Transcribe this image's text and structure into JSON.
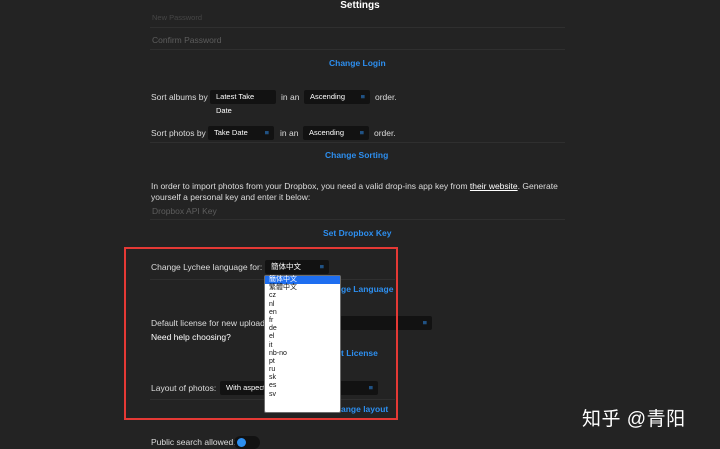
{
  "header": {
    "title": "Settings"
  },
  "login": {
    "new_password_placeholder": "New Password",
    "confirm_password_placeholder": "Confirm Password",
    "change_login_label": "Change Login"
  },
  "sorting": {
    "sort_albums_by": "Sort albums by",
    "albums_field": "Latest Take Date",
    "in_an": "in an",
    "albums_order": "Ascending",
    "order_suffix": "order.",
    "sort_photos_by": "Sort photos by",
    "photos_field": "Take Date",
    "photos_order": "Ascending",
    "change_sorting_label": "Change Sorting"
  },
  "dropbox": {
    "info_prefix": "In order to import photos from your Dropbox, you need a valid drop-ins app key from",
    "their_website": "their website",
    "info_suffix": ". Generate",
    "info_line2": "yourself a personal key and enter it below:",
    "api_key_placeholder": "Dropbox API Key",
    "set_key_label": "Set Dropbox Key"
  },
  "language": {
    "label": "Change Lychee language for:",
    "current": "簡体中文",
    "button_partial": "ge Language",
    "options": [
      "簡体中文",
      "繁體中文",
      "cz",
      "nl",
      "en",
      "fr",
      "de",
      "el",
      "it",
      "nb-no",
      "pt",
      "ru",
      "sk",
      "es",
      "sv"
    ],
    "selected_index": 0
  },
  "license": {
    "label": "Default license for new uploads",
    "help": "Need help choosing?",
    "button_partial": "t License"
  },
  "layout": {
    "label": "Layout of photos:",
    "current_partial": "With aspect,",
    "button_partial": "ange layout"
  },
  "public_search": {
    "label": "Public search allowed:",
    "enabled": true
  },
  "watermark": "知乎 @青阳",
  "caret_glyph": "≡",
  "colors": {
    "accent": "#2d8ff0",
    "highlight_border": "#e53935",
    "background": "#232323"
  }
}
